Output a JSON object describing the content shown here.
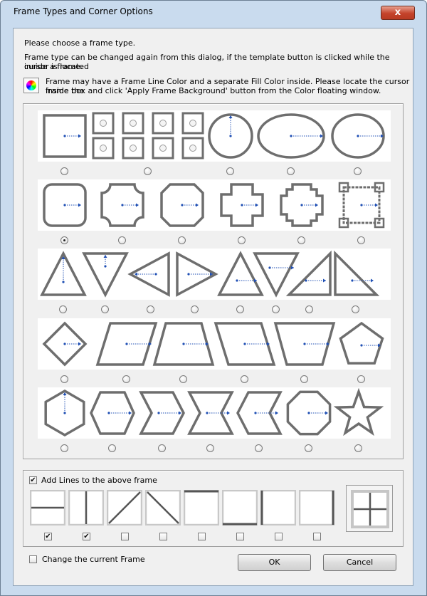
{
  "window": {
    "title": "Frame Types and Corner Options",
    "close_label": "x"
  },
  "intro": {
    "line1": "Please choose a frame type.",
    "line2a": "Frame type can be changed again from this dialog, if the template button is clicked while the cursor is located",
    "line2b": "inside a frame.",
    "line3a": "Frame may have a Frame Line Color and a separate Fill Color inside. Please locate the cursor inside the",
    "line3b": "frame box and click 'Apply Frame Background' button from the Color floating window."
  },
  "frame_types": {
    "selected": "rounded-rectangle",
    "rows": [
      [
        "rectangle",
        "rectangle-corner-options",
        "circle",
        "ellipse",
        "oval"
      ],
      [
        "rounded-rectangle",
        "inner-rounded-rectangle",
        "chamfered-rectangle",
        "cross",
        "stepped-cross",
        "notched-rectangle"
      ],
      [
        "triangle-up",
        "triangle-down",
        "triangle-left",
        "triangle-right",
        "triangle-up-wide",
        "triangle-down-wide",
        "right-triangle-right",
        "right-triangle-left"
      ],
      [
        "diamond",
        "parallelogram",
        "trapezoid",
        "parallelogram-reverse",
        "trapezoid-inverted",
        "pentagon"
      ],
      [
        "hexagon-vertical",
        "hexagon",
        "chevron",
        "bowtie",
        "chevron-reverse",
        "octagon",
        "star"
      ]
    ]
  },
  "lines_section": {
    "label": "Add Lines to the above frame",
    "checked": true,
    "options": [
      {
        "name": "horizontal-middle",
        "checked": true
      },
      {
        "name": "vertical-middle",
        "checked": true
      },
      {
        "name": "diagonal-up",
        "checked": false
      },
      {
        "name": "diagonal-down",
        "checked": false
      },
      {
        "name": "top-line",
        "checked": false
      },
      {
        "name": "bottom-line",
        "checked": false
      },
      {
        "name": "left-line",
        "checked": false
      },
      {
        "name": "right-line",
        "checked": false
      }
    ]
  },
  "change_current": {
    "label": "Change the current Frame",
    "checked": false
  },
  "buttons": {
    "ok": "OK",
    "cancel": "Cancel"
  }
}
